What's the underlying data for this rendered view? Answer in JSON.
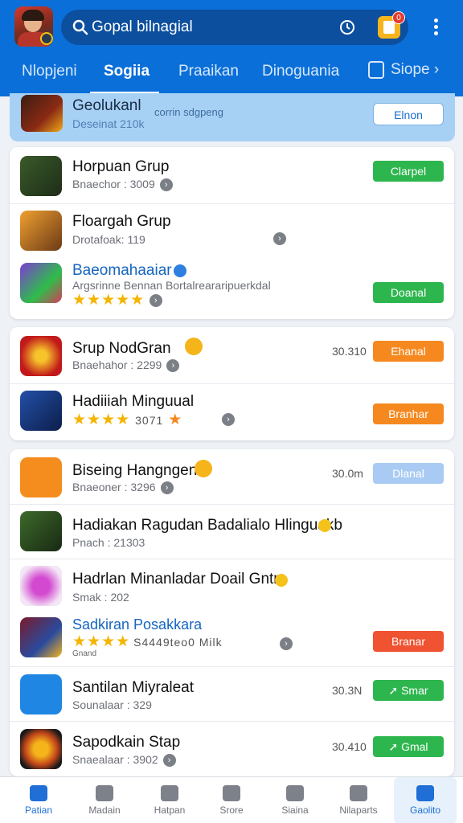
{
  "header": {
    "search_text": "Gopal bilnagial",
    "notification_count": "0",
    "tabs": [
      "Nlopjeni",
      "Sogiia",
      "Praaikan",
      "Dinoguania",
      "Siope ›"
    ]
  },
  "featured": {
    "title": "Geolukanl",
    "title_extra": "corrin sdgpeng",
    "subtitle": "Deseinat 210k",
    "button": "Elnon"
  },
  "apps": [
    {
      "title": "Horpuan Grup",
      "sub": "Bnaechor : 3009",
      "button": "Clarpel"
    },
    {
      "title": "Floargah Grup",
      "sub": "Drotafoak: 119"
    },
    {
      "title": "Baeomahaaiar",
      "sub": "Argsrinne Bennan Bortalreararipuerkdal",
      "button": "Doanal"
    },
    {
      "title": "Srup NodGran",
      "sub": "Bnaehahor : 2299",
      "size": "30.310",
      "button": "Ehanal"
    },
    {
      "title": "Hadiiiah Minguual",
      "sub": "3071",
      "button": "Branhar"
    },
    {
      "title": "Biseing Hangngen",
      "sub": "Bnaeoner : 3296",
      "size": "30.0m",
      "button": "Dlanal"
    },
    {
      "title": "Hadiakan Ragudan Badalialo Hlinguakb",
      "sub": "Pnach : 21303"
    },
    {
      "title": "Hadrlan Minanladar Doail Gntr",
      "sub": "Smak : 202"
    },
    {
      "title": "Sadkiran Posakkara",
      "sub": "S4449teo0 Milk",
      "sub2": "Gnand",
      "button": "Branar"
    },
    {
      "title": "Santilan Miyraleat",
      "sub": "Sounalaar : 329",
      "size": "30.3N",
      "button": "Smar"
    },
    {
      "title": "Sapodkain Stap",
      "sub": "Snaealaar : 3902",
      "size": "30.410",
      "button": "Gmal"
    }
  ],
  "nav": [
    "Patian",
    "Madain",
    "Hatpan",
    "Srore",
    "Siaina",
    "Nilaparts",
    "Gaolito"
  ],
  "colors": {
    "header": "#0a6fd8",
    "accent_green": "#2eb64e",
    "accent_orange": "#f5891f",
    "accent_red": "#ef5331"
  }
}
